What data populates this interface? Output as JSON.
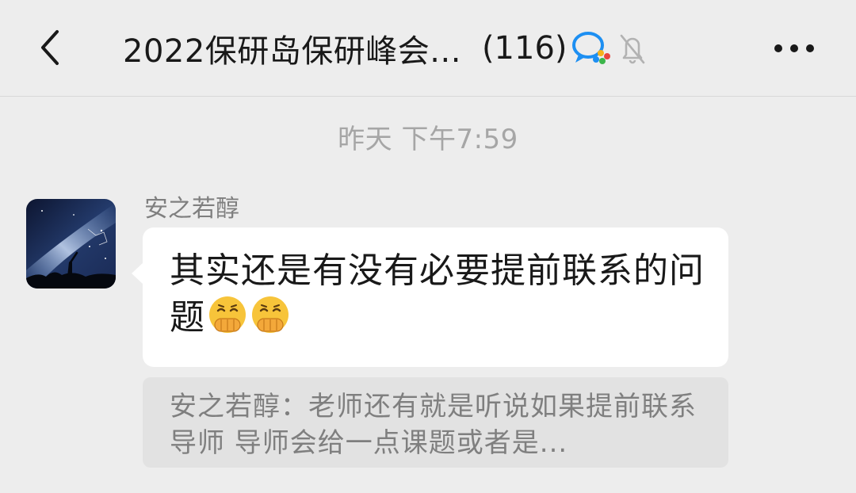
{
  "header": {
    "back_icon": "chevron-left-icon",
    "title": "2022保研岛保研峰会...",
    "member_count": "(116)",
    "wecom_icon": "wecom-chat-icon",
    "mute_icon": "bell-muted-icon",
    "more_icon": "ellipsis-icon"
  },
  "chat": {
    "timestamp": "昨天 下午7:59",
    "messages": [
      {
        "sender": "安之若醇",
        "avatar": "starry-sky-avatar",
        "text": "其实还是有没有必要提前联系的问题",
        "emojis": [
          "grimacing-hand-over-mouth-emoji",
          "grimacing-hand-over-mouth-emoji"
        ],
        "quote": "安之若醇：老师还有就是听说如果提前联系导师 导师会给一点课题或者是..."
      }
    ]
  },
  "colors": {
    "background": "#ededed",
    "bubble": "#ffffff",
    "quote_bg": "#e2e2e2",
    "secondary_text": "#7f7f7f",
    "timestamp_text": "#a6a6a6"
  }
}
